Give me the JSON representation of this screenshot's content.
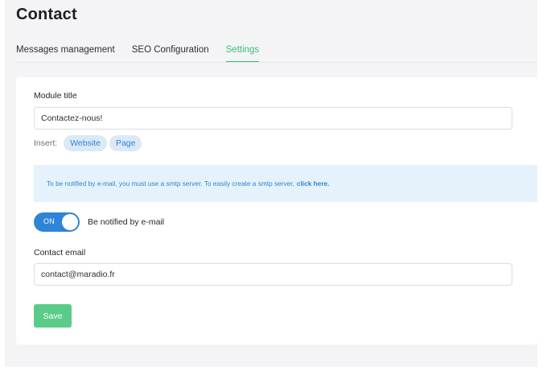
{
  "page": {
    "title": "Contact"
  },
  "tabs": [
    {
      "label": "Messages management",
      "active": false
    },
    {
      "label": "SEO Configuration",
      "active": false
    },
    {
      "label": "Settings",
      "active": true
    }
  ],
  "form": {
    "module_title": {
      "label": "Module title",
      "value": "Contactez-nous!"
    },
    "insert": {
      "label": "Insert:",
      "chips": [
        "Website",
        "Page"
      ]
    },
    "notice": {
      "text": "To be notified by e-mail, you must use a smtp server. To easily create a smtp server,",
      "link": "click here."
    },
    "notify_toggle": {
      "state": "ON",
      "on": true,
      "label": "Be notified by e-mail"
    },
    "contact_email": {
      "label": "Contact email",
      "value": "contact@maradio.fr"
    },
    "save_label": "Save"
  },
  "colors": {
    "accent_green": "#3dbf7a",
    "save_button": "#5acc89",
    "primary_blue": "#2f84d6",
    "chip_bg": "#dbe9f7",
    "notice_bg": "#e6f2fb"
  }
}
